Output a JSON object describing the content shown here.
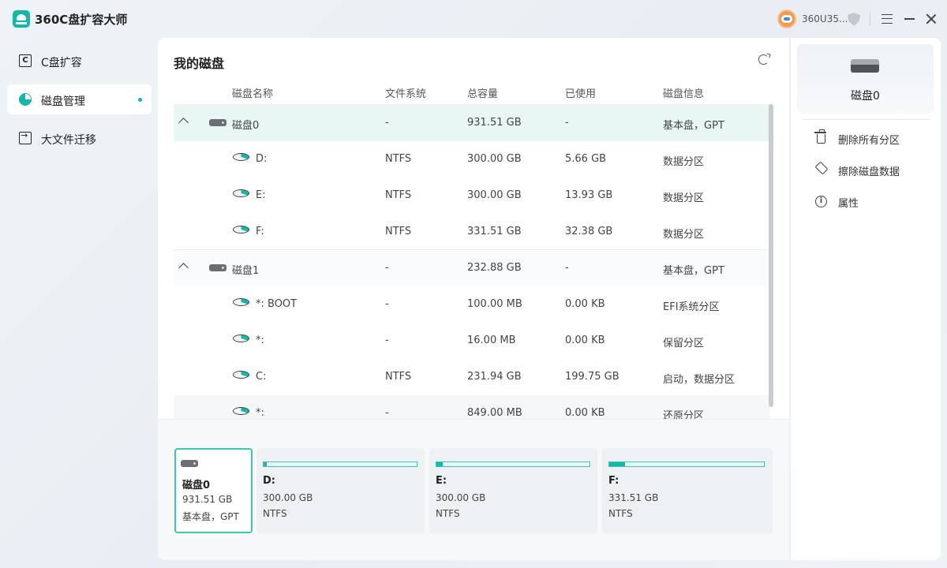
{
  "app": {
    "title": "360C盘扩容大师",
    "user_name": "360U35..."
  },
  "sidebar": {
    "items": [
      {
        "label": "C盘扩容",
        "icon": "c-drive-icon"
      },
      {
        "label": "磁盘管理",
        "icon": "pie-chart-icon",
        "active": true
      },
      {
        "label": "大文件迁移",
        "icon": "file-migrate-icon"
      }
    ]
  },
  "main": {
    "title": "我的磁盘",
    "columns": [
      "磁盘名称",
      "文件系统",
      "总容量",
      "已使用",
      "磁盘信息"
    ],
    "rows": [
      {
        "type": "disk",
        "name": "磁盘0",
        "fs": "-",
        "total": "931.51  GB",
        "used": "-",
        "info": "基本盘，GPT"
      },
      {
        "type": "part",
        "name": "D:",
        "fs": "NTFS",
        "total": "300.00  GB",
        "used": "5.66  GB",
        "info": "数据分区"
      },
      {
        "type": "part",
        "name": "E:",
        "fs": "NTFS",
        "total": "300.00  GB",
        "used": "13.93  GB",
        "info": "数据分区"
      },
      {
        "type": "part",
        "name": "F:",
        "fs": "NTFS",
        "total": "331.51  GB",
        "used": "32.38  GB",
        "info": "数据分区"
      },
      {
        "type": "disk",
        "name": "磁盘1",
        "fs": "-",
        "total": "232.88  GB",
        "used": "-",
        "info": "基本盘，GPT"
      },
      {
        "type": "part",
        "name": "*: BOOT",
        "fs": "-",
        "total": "100.00  MB",
        "used": "0.00 KB",
        "info": "EFI系统分区"
      },
      {
        "type": "part",
        "name": "*:",
        "fs": "-",
        "total": "16.00  MB",
        "used": "0.00 KB",
        "info": "保留分区"
      },
      {
        "type": "part",
        "name": "C:",
        "fs": "NTFS",
        "total": "231.94  GB",
        "used": "199.75  GB",
        "info": "启动，数据分区"
      },
      {
        "type": "part",
        "name": "*:",
        "fs": "-",
        "total": "849.00  MB",
        "used": "0.00 KB",
        "info": "还原分区"
      }
    ]
  },
  "cards": [
    {
      "name": "磁盘0",
      "size": "931.51  GB",
      "fs": "基本盘，GPT",
      "type": "disk"
    },
    {
      "name": "D:",
      "size": "300.00  GB",
      "fs": "NTFS",
      "used_fraction": 0.02
    },
    {
      "name": "E:",
      "size": "300.00  GB",
      "fs": "NTFS",
      "used_fraction": 0.04
    },
    {
      "name": "F:",
      "size": "331.51  GB",
      "fs": "NTFS",
      "used_fraction": 0.1
    }
  ],
  "right_panel": {
    "disk_name": "磁盘0",
    "actions": [
      {
        "label": "删除所有分区",
        "icon": "trash-icon"
      },
      {
        "label": "擦除磁盘数据",
        "icon": "eraser-icon"
      },
      {
        "label": "属性",
        "icon": "info-icon"
      }
    ]
  },
  "colors": {
    "accent": "#14b8a6",
    "selected_row": "#e8f7f3"
  }
}
